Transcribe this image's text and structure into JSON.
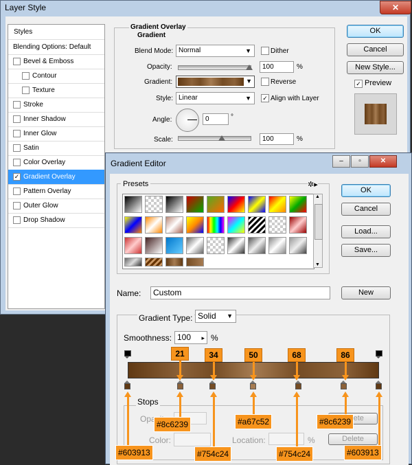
{
  "layer_style": {
    "title": "Layer Style",
    "close": "✕",
    "sidebar": {
      "styles_label": "Styles",
      "items": [
        {
          "label": "Blending Options: Default",
          "check": false,
          "hasbox": false,
          "sel": false,
          "indent": false
        },
        {
          "label": "Bevel & Emboss",
          "check": false,
          "hasbox": true,
          "sel": false,
          "indent": false
        },
        {
          "label": "Contour",
          "check": false,
          "hasbox": true,
          "sel": false,
          "indent": true
        },
        {
          "label": "Texture",
          "check": false,
          "hasbox": true,
          "sel": false,
          "indent": true
        },
        {
          "label": "Stroke",
          "check": false,
          "hasbox": true,
          "sel": false,
          "indent": false
        },
        {
          "label": "Inner Shadow",
          "check": false,
          "hasbox": true,
          "sel": false,
          "indent": false
        },
        {
          "label": "Inner Glow",
          "check": false,
          "hasbox": true,
          "sel": false,
          "indent": false
        },
        {
          "label": "Satin",
          "check": false,
          "hasbox": true,
          "sel": false,
          "indent": false
        },
        {
          "label": "Color Overlay",
          "check": false,
          "hasbox": true,
          "sel": false,
          "indent": false
        },
        {
          "label": "Gradient Overlay",
          "check": true,
          "hasbox": true,
          "sel": true,
          "indent": false
        },
        {
          "label": "Pattern Overlay",
          "check": false,
          "hasbox": true,
          "sel": false,
          "indent": false
        },
        {
          "label": "Outer Glow",
          "check": false,
          "hasbox": true,
          "sel": false,
          "indent": false
        },
        {
          "label": "Drop Shadow",
          "check": false,
          "hasbox": true,
          "sel": false,
          "indent": false
        }
      ]
    },
    "panel": {
      "group_title": "Gradient Overlay",
      "sub_title": "Gradient",
      "blend_mode_label": "Blend Mode:",
      "blend_mode_value": "Normal",
      "dither_label": "Dither",
      "opacity_label": "Opacity:",
      "opacity_value": "100",
      "opacity_unit": "%",
      "gradient_label": "Gradient:",
      "reverse_label": "Reverse",
      "style_label": "Style:",
      "style_value": "Linear",
      "align_label": "Align with Layer",
      "angle_label": "Angle:",
      "angle_value": "0",
      "angle_unit": "°",
      "scale_label": "Scale:",
      "scale_value": "100",
      "scale_unit": "%"
    },
    "buttons": {
      "ok": "OK",
      "cancel": "Cancel",
      "new_style": "New Style...",
      "preview": "Preview"
    }
  },
  "gradient_editor": {
    "title": "Gradient Editor",
    "presets_label": "Presets",
    "name_label": "Name:",
    "name_value": "Custom",
    "new_button": "New",
    "ok": "OK",
    "cancel": "Cancel",
    "load": "Load...",
    "save": "Save...",
    "type_label": "Gradient Type:",
    "type_value": "Solid",
    "smoothness_label": "Smoothness:",
    "smoothness_value": "100",
    "smoothness_unit": "%",
    "stops_label": "Stops",
    "opacity_label": "Opacity:",
    "color_label": "Color:",
    "location_label": "Location:",
    "location_unit": "%",
    "delete_label": "Delete"
  },
  "gradient_stops": [
    {
      "location": 0,
      "color": "#603913"
    },
    {
      "location": 21,
      "color": "#8c6239"
    },
    {
      "location": 34,
      "color": "#754c24"
    },
    {
      "location": 50,
      "color": "#a67c52"
    },
    {
      "location": 68,
      "color": "#754c24"
    },
    {
      "location": 86,
      "color": "#8c6239"
    },
    {
      "location": 100,
      "color": "#603913"
    }
  ],
  "callouts": {
    "c21": "21",
    "c34": "34",
    "c50": "50",
    "c68": "68",
    "c86": "86"
  },
  "hex_labels": {
    "h0": "#603913",
    "h21": "#8c6239",
    "h34": "#754c24",
    "h50": "#a67c52",
    "h68": "#754c24",
    "h86": "#8c6239",
    "h100": "#603913"
  }
}
